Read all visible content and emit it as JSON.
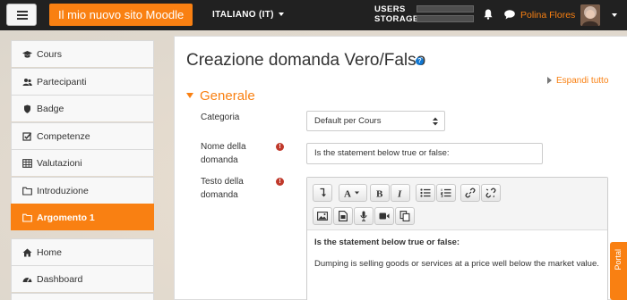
{
  "navbar": {
    "site_name": "Il mio nuovo sito Moodle",
    "language": "ITALIANO (IT)",
    "quota_users_label": "USERS",
    "quota_storage_label": "STORAGE",
    "quota_users_fraction": 0.0,
    "quota_storage_fraction": 0.0,
    "user_name": "Polina Flores",
    "icons": [
      "menu-icon",
      "bell-icon",
      "chat-icon",
      "caret-down-icon"
    ]
  },
  "sidebar": {
    "items": [
      {
        "label": "Cours",
        "icon": "graduation-cap-icon"
      },
      {
        "label": "Partecipanti",
        "icon": "users-icon"
      },
      {
        "label": "Badge",
        "icon": "shield-icon"
      },
      {
        "label": "Competenze",
        "icon": "checkbox-icon"
      },
      {
        "label": "Valutazioni",
        "icon": "table-icon"
      },
      {
        "label": "Introduzione",
        "icon": "folder-icon"
      },
      {
        "label": "Argomento 1",
        "icon": "folder-icon",
        "active": true
      },
      {
        "label": "Home",
        "icon": "home-icon"
      },
      {
        "label": "Dashboard",
        "icon": "dashboard-icon"
      }
    ]
  },
  "main": {
    "title": "Creazione domanda Vero/Falso",
    "expand_all": "Espandi tutto",
    "section_title": "Generale",
    "fields": {
      "category_label": "Categoria",
      "category_value": "Default per Cours",
      "name_label": "Nome della domanda",
      "name_value": "Is the statement below true or false:",
      "text_label": "Testo della domanda"
    },
    "editor": {
      "line1": "Is the statement below true or false:",
      "line2": "Dumping is selling goods or services at a price well below the market value."
    }
  },
  "portal_tab": "Portal",
  "colors": {
    "brand": "#f98012",
    "navbar": "#212121",
    "required": "#c0392b",
    "help": "#1177d1"
  }
}
